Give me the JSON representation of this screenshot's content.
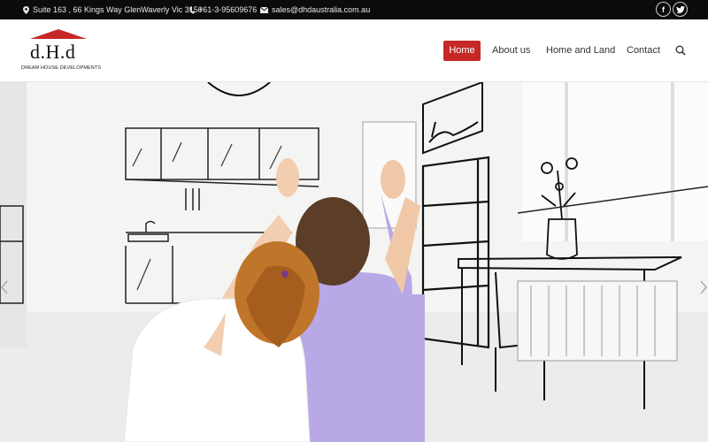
{
  "topbar": {
    "address": "Suite 163 , 66 Kings Way GlenWaverly Vic 3150",
    "phone": "+61-3-95609676",
    "email": "sales@dhdaustralia.com.au",
    "social": [
      {
        "label": "f",
        "icon": "facebook-icon"
      },
      {
        "label": "t",
        "icon": "twitter-icon"
      }
    ]
  },
  "logo": {
    "text": "d.H.d",
    "subtitle": "DREAM HOUSE DEVELOPMENTS"
  },
  "nav": {
    "items": [
      "Home",
      "About us",
      "Home and Land",
      "Contact"
    ],
    "active": "Home"
  },
  "colors": {
    "topbar": "#0b0b0b",
    "accent": "#c62828",
    "nav_text": "#333333"
  }
}
